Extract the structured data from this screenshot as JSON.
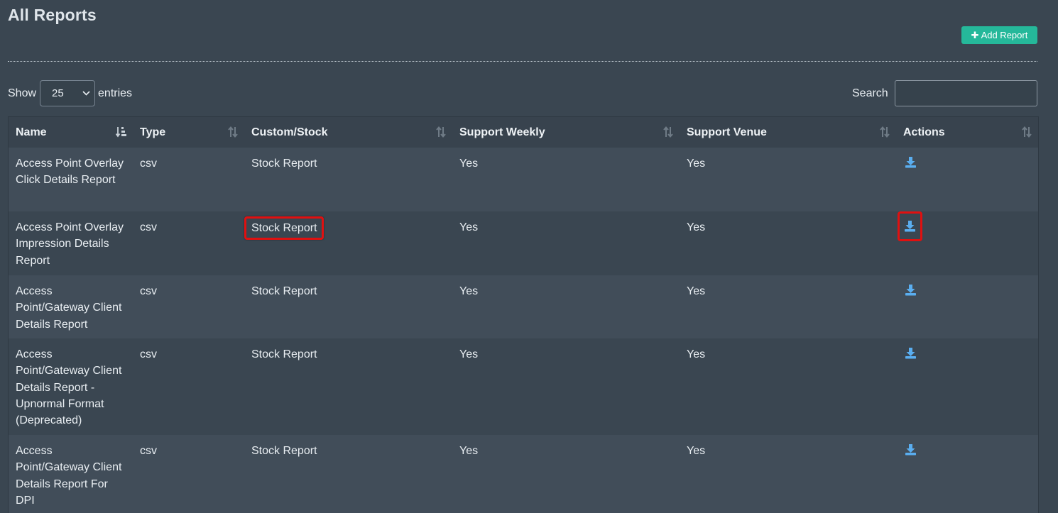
{
  "page": {
    "title": "All Reports"
  },
  "toolbar": {
    "add_report_label": "Add Report"
  },
  "length_menu": {
    "show_label": "Show",
    "value": "25",
    "entries_label": "entries"
  },
  "search": {
    "label": "Search",
    "value": "",
    "placeholder": ""
  },
  "table": {
    "columns": [
      "Name",
      "Type",
      "Custom/Stock",
      "Support Weekly",
      "Support Venue",
      "Actions"
    ],
    "rows": [
      {
        "name": "Access Point Overlay Click Details Report",
        "type": "csv",
        "custom_stock": "Stock Report",
        "support_weekly": "Yes",
        "support_venue": "Yes",
        "action_icon": "download-icon"
      },
      {
        "name": "Access Point Overlay Impression Details Report",
        "type": "csv",
        "custom_stock": "Stock Report",
        "support_weekly": "Yes",
        "support_venue": "Yes",
        "action_icon": "download-icon"
      },
      {
        "name": "Access Point/Gateway Client Details Report",
        "type": "csv",
        "custom_stock": "Stock Report",
        "support_weekly": "Yes",
        "support_venue": "Yes",
        "action_icon": "download-icon"
      },
      {
        "name": "Access Point/Gateway Client Details Report - Upnormal Format (Deprecated)",
        "type": "csv",
        "custom_stock": "Stock Report",
        "support_weekly": "Yes",
        "support_venue": "Yes",
        "action_icon": "download-icon"
      },
      {
        "name": "Access Point/Gateway Client Details Report For DPI",
        "type": "csv",
        "custom_stock": "Stock Report",
        "support_weekly": "Yes",
        "support_venue": "Yes",
        "action_icon": "download-icon"
      }
    ]
  },
  "colors": {
    "background": "#3a4651",
    "row_alt": "#414d59",
    "accent_button": "#25b89a",
    "download_icon": "#5aaef0",
    "highlight_box": "#e01010"
  }
}
